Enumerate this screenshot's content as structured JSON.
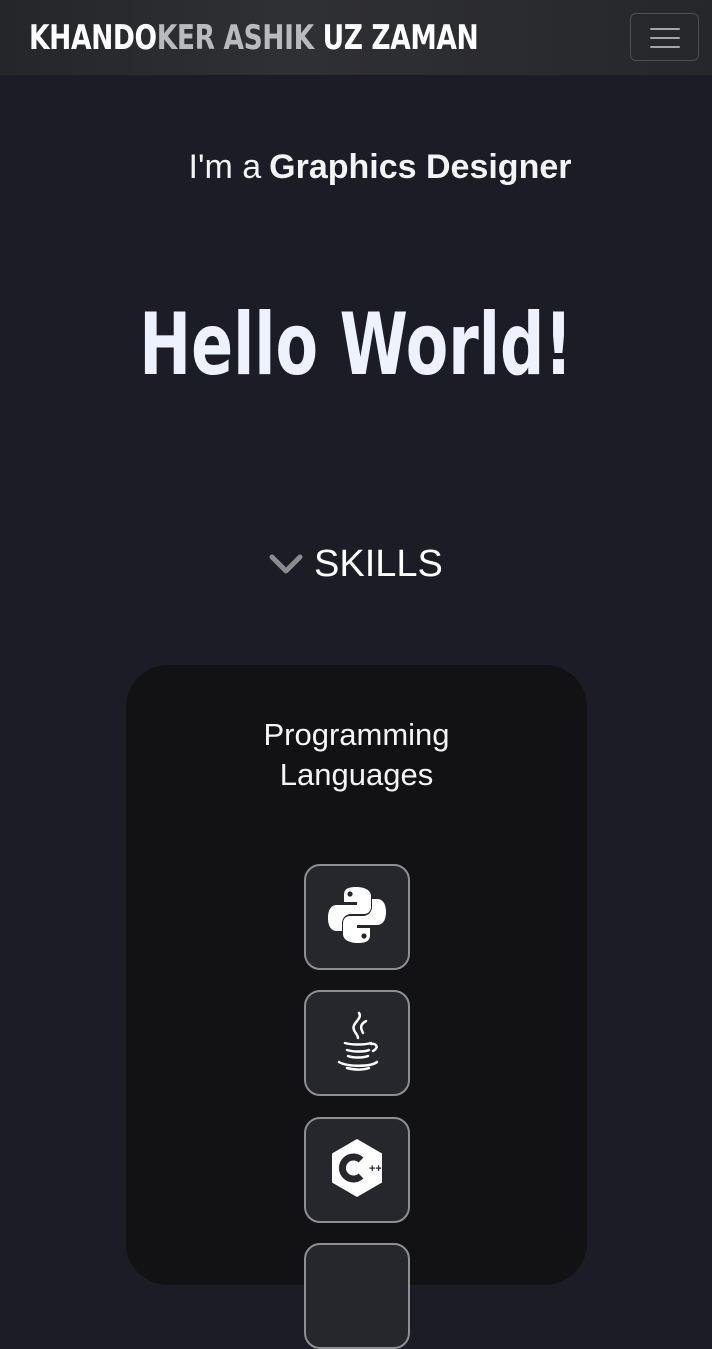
{
  "navbar": {
    "brand_part1": "KHANDO",
    "brand_part2": "KER ASHIK",
    "brand_part3": " UZ ZAMAN",
    "menu_icon": "hamburger-menu-icon"
  },
  "hero": {
    "tagline_prefix": "I'm a",
    "tagline_role": "Graphics Designer",
    "greeting": "Hello World!"
  },
  "skills": {
    "toggle_icon": "chevron-down-icon",
    "label": "SKILLS",
    "card": {
      "title_line1": "Programming",
      "title_line2": "Languages",
      "items": [
        {
          "icon": "python-icon"
        },
        {
          "icon": "java-icon"
        },
        {
          "icon": "cplusplus-icon"
        },
        {
          "icon": "language-icon"
        }
      ]
    }
  },
  "colors": {
    "background": "#1b1c25",
    "navbar": "#2b2c30",
    "card": "#121214",
    "tile": "#26272c",
    "tile_border": "#8e8f93",
    "chevron": "#8a8b8f",
    "hello": "#eef2ff"
  }
}
